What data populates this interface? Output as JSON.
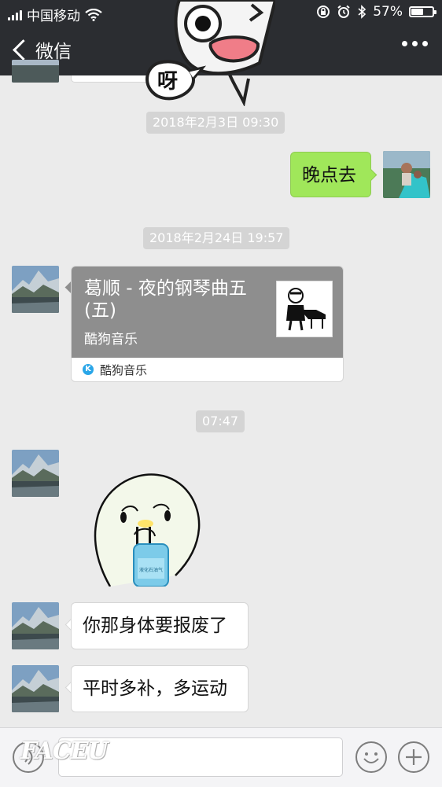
{
  "status": {
    "carrier": "中国移动",
    "battery_text": "57%",
    "battery_level": 0.57
  },
  "nav": {
    "back_label": "微信",
    "more_icon": "more-icon"
  },
  "top_sticker_text": "呀",
  "messages": {
    "ts1": "2018年2月3日 09:30",
    "mine1": "晚点去",
    "ts2": "2018年2月24日 19:57",
    "music": {
      "title": "葛顺 - 夜的钢琴曲五(五)",
      "source": "酷狗音乐",
      "app_name": "酷狗音乐",
      "app_icon_letter": "K"
    },
    "ts3": "07:47",
    "sticker_bottle_text": "液化石油气",
    "msg1": "你那身体要报废了",
    "msg2": "平时多补，多运动"
  },
  "input": {
    "placeholder": "",
    "voice_icon": "voice-icon",
    "emoji_icon": "emoji-icon",
    "plus_icon": "plus-icon"
  },
  "watermark": "FACEU",
  "colors": {
    "header_bg": "#2b2d31",
    "chat_bg": "#ebebeb",
    "mine_bubble": "#a0e75a",
    "timestamp_bg": "#d4d4d4"
  }
}
